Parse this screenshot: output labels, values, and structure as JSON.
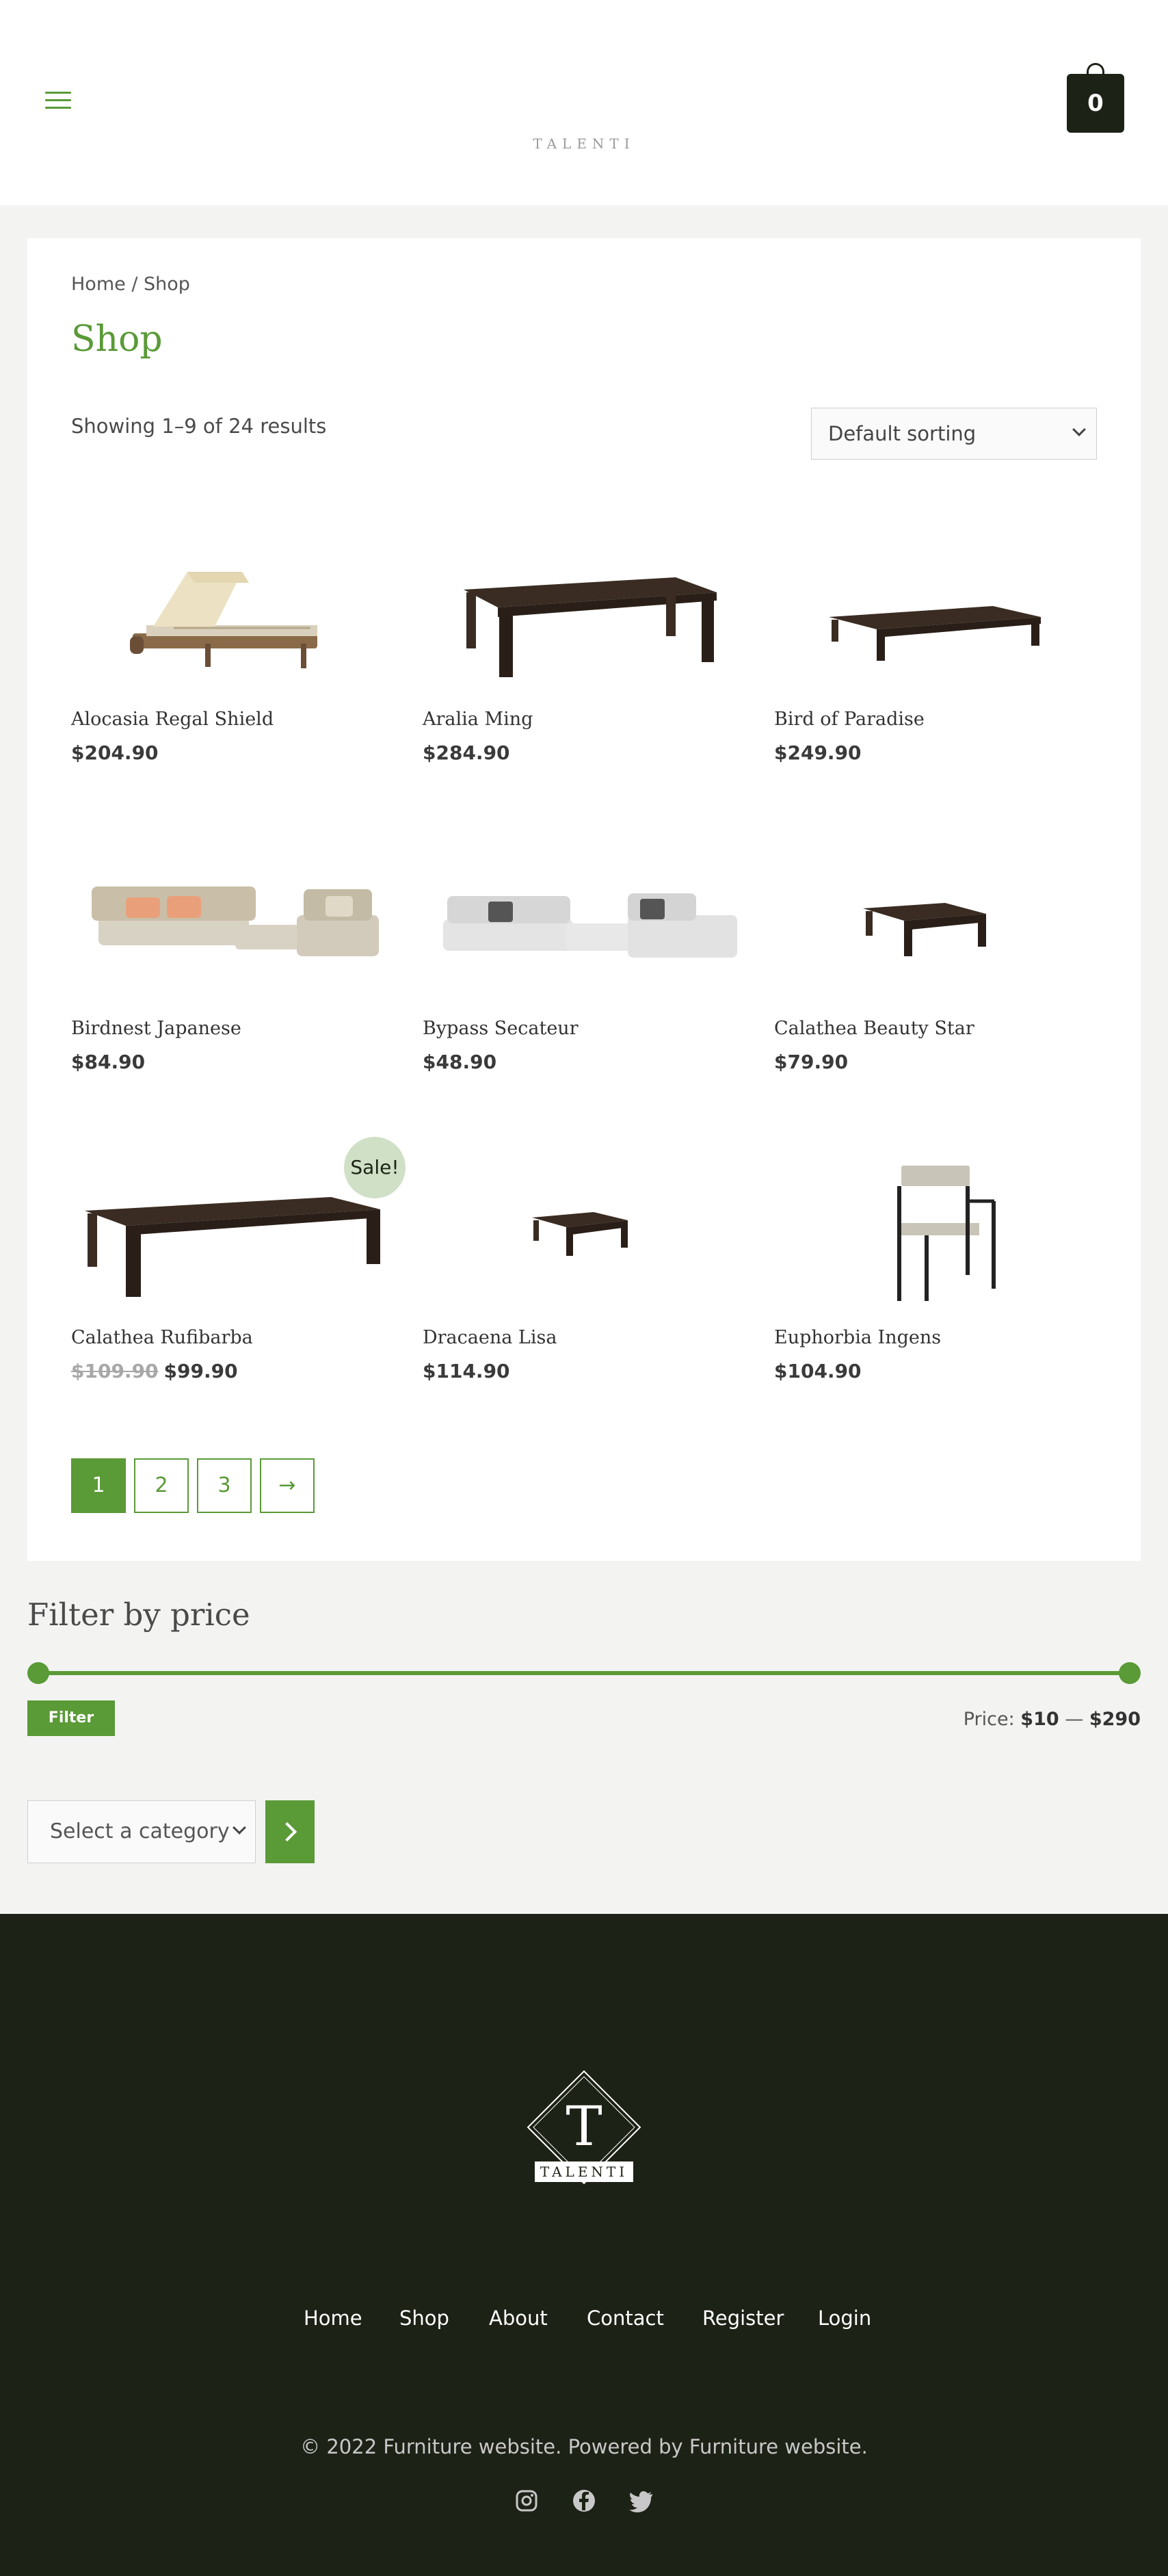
{
  "header": {
    "logo_text": "TALENTI",
    "cart_count": "0",
    "menu_icon": "hamburger-icon",
    "cart_icon": "shopping-bag-icon"
  },
  "breadcrumb": "Home / Shop",
  "page_title": "Shop",
  "result_count": "Showing 1–9 of 24 results",
  "sorting": {
    "selected": "Default sorting"
  },
  "products": [
    {
      "name": "Alocasia Regal Shield",
      "price": "$204.90",
      "image": "sun-lounger"
    },
    {
      "name": "Aralia Ming",
      "price": "$284.90",
      "image": "dining-table"
    },
    {
      "name": "Bird of Paradise",
      "price": "$249.90",
      "image": "low-table"
    },
    {
      "name": "Birdnest Japanese",
      "price": "$84.90",
      "image": "modular-sofa-beige"
    },
    {
      "name": "Bypass Secateur",
      "price": "$48.90",
      "image": "modular-sofa-white"
    },
    {
      "name": "Calathea Beauty Star",
      "price": "$79.90",
      "image": "coffee-table"
    },
    {
      "name": "Calathea Rufibarba",
      "price": "$99.90",
      "old_price": "$109.90",
      "sale_badge": "Sale!",
      "image": "long-table"
    },
    {
      "name": "Dracaena Lisa",
      "price": "$114.90",
      "image": "small-table"
    },
    {
      "name": "Euphorbia Ingens",
      "price": "$104.90",
      "image": "armchair"
    }
  ],
  "pagination": {
    "pages": [
      "1",
      "2",
      "3"
    ],
    "current": "1",
    "next": "→"
  },
  "filter": {
    "title": "Filter by price",
    "button": "Filter",
    "price_label": "Price:",
    "min": "$10",
    "separator": "—",
    "max": "$290"
  },
  "category": {
    "placeholder": "Select a category"
  },
  "footer": {
    "logo_text": "TALENTI",
    "logo_letter": "T",
    "nav": [
      "Home",
      "Shop",
      "About",
      "Contact",
      "Register",
      "Login"
    ],
    "copyright": "© 2022 Furniture website. Powered by Furniture website.",
    "social": [
      "instagram-icon",
      "facebook-icon",
      "twitter-icon"
    ]
  },
  "colors": {
    "accent": "#5a9a37",
    "dark": "#1d2216",
    "background": "#f3f4f2"
  }
}
